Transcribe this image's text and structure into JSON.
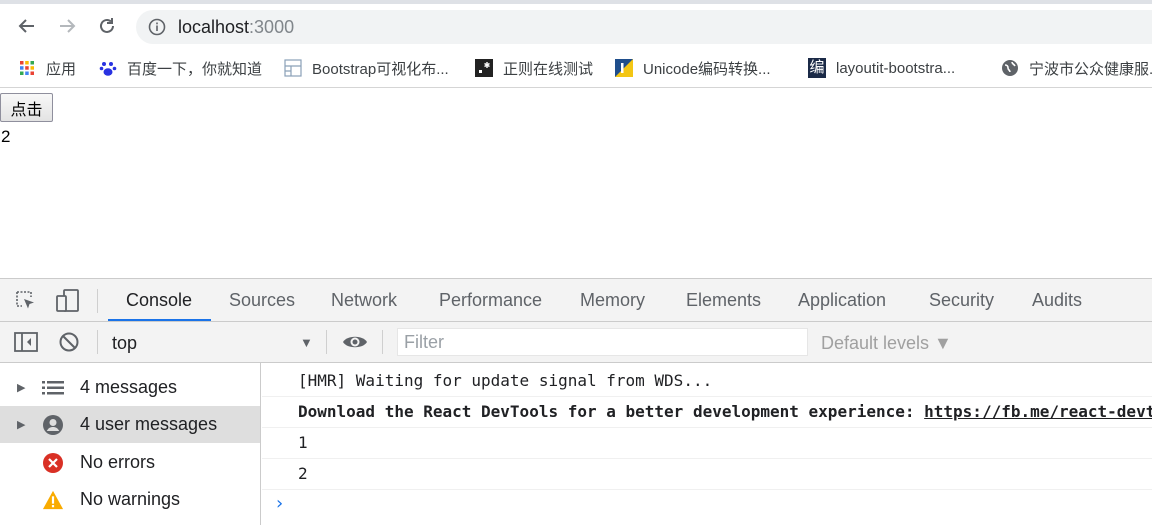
{
  "browser": {
    "url_host": "localhost",
    "url_port": ":3000",
    "bookmarks": [
      {
        "label": "应用",
        "icon": "apps-grid-icon"
      },
      {
        "label": "百度一下，你就知道",
        "icon": "baidu-paw-icon"
      },
      {
        "label": "Bootstrap可视化布...",
        "icon": "layout-grid-icon"
      },
      {
        "label": "正则在线测试",
        "icon": "regex-icon"
      },
      {
        "label": "Unicode编码转换...",
        "icon": "unicode-icon"
      },
      {
        "label": "layoutit-bootstra...",
        "icon": "bian-icon"
      },
      {
        "label": "宁波市公众健康服...",
        "icon": "globe-icon"
      }
    ],
    "bian_glyph": "编"
  },
  "page": {
    "button_label": "点击",
    "count": "2"
  },
  "devtools": {
    "tabs": [
      "Console",
      "Sources",
      "Network",
      "Performance",
      "Memory",
      "Elements",
      "Application",
      "Security",
      "Audits"
    ],
    "active_tab": "Console",
    "context": "top",
    "filter_placeholder": "Filter",
    "levels": "Default levels ▼",
    "sidebar": [
      {
        "label": "4 messages",
        "icon": "list-icon",
        "expandable": true
      },
      {
        "label": "4 user messages",
        "icon": "user-icon",
        "expandable": true,
        "selected": true
      },
      {
        "label": "No errors",
        "icon": "error-icon",
        "expandable": false
      },
      {
        "label": "No warnings",
        "icon": "warning-icon",
        "expandable": false
      }
    ],
    "messages": [
      {
        "text": "[HMR] Waiting for update signal from WDS..."
      },
      {
        "text": "Download the React DevTools for a better development experience: ",
        "link": "https://fb.me/react-devtools"
      },
      {
        "text": "1"
      },
      {
        "text": "2"
      }
    ],
    "prompt": "›"
  },
  "colors": {
    "accent": "#1a73e8",
    "error": "#d93025",
    "warning": "#f9ab00"
  }
}
